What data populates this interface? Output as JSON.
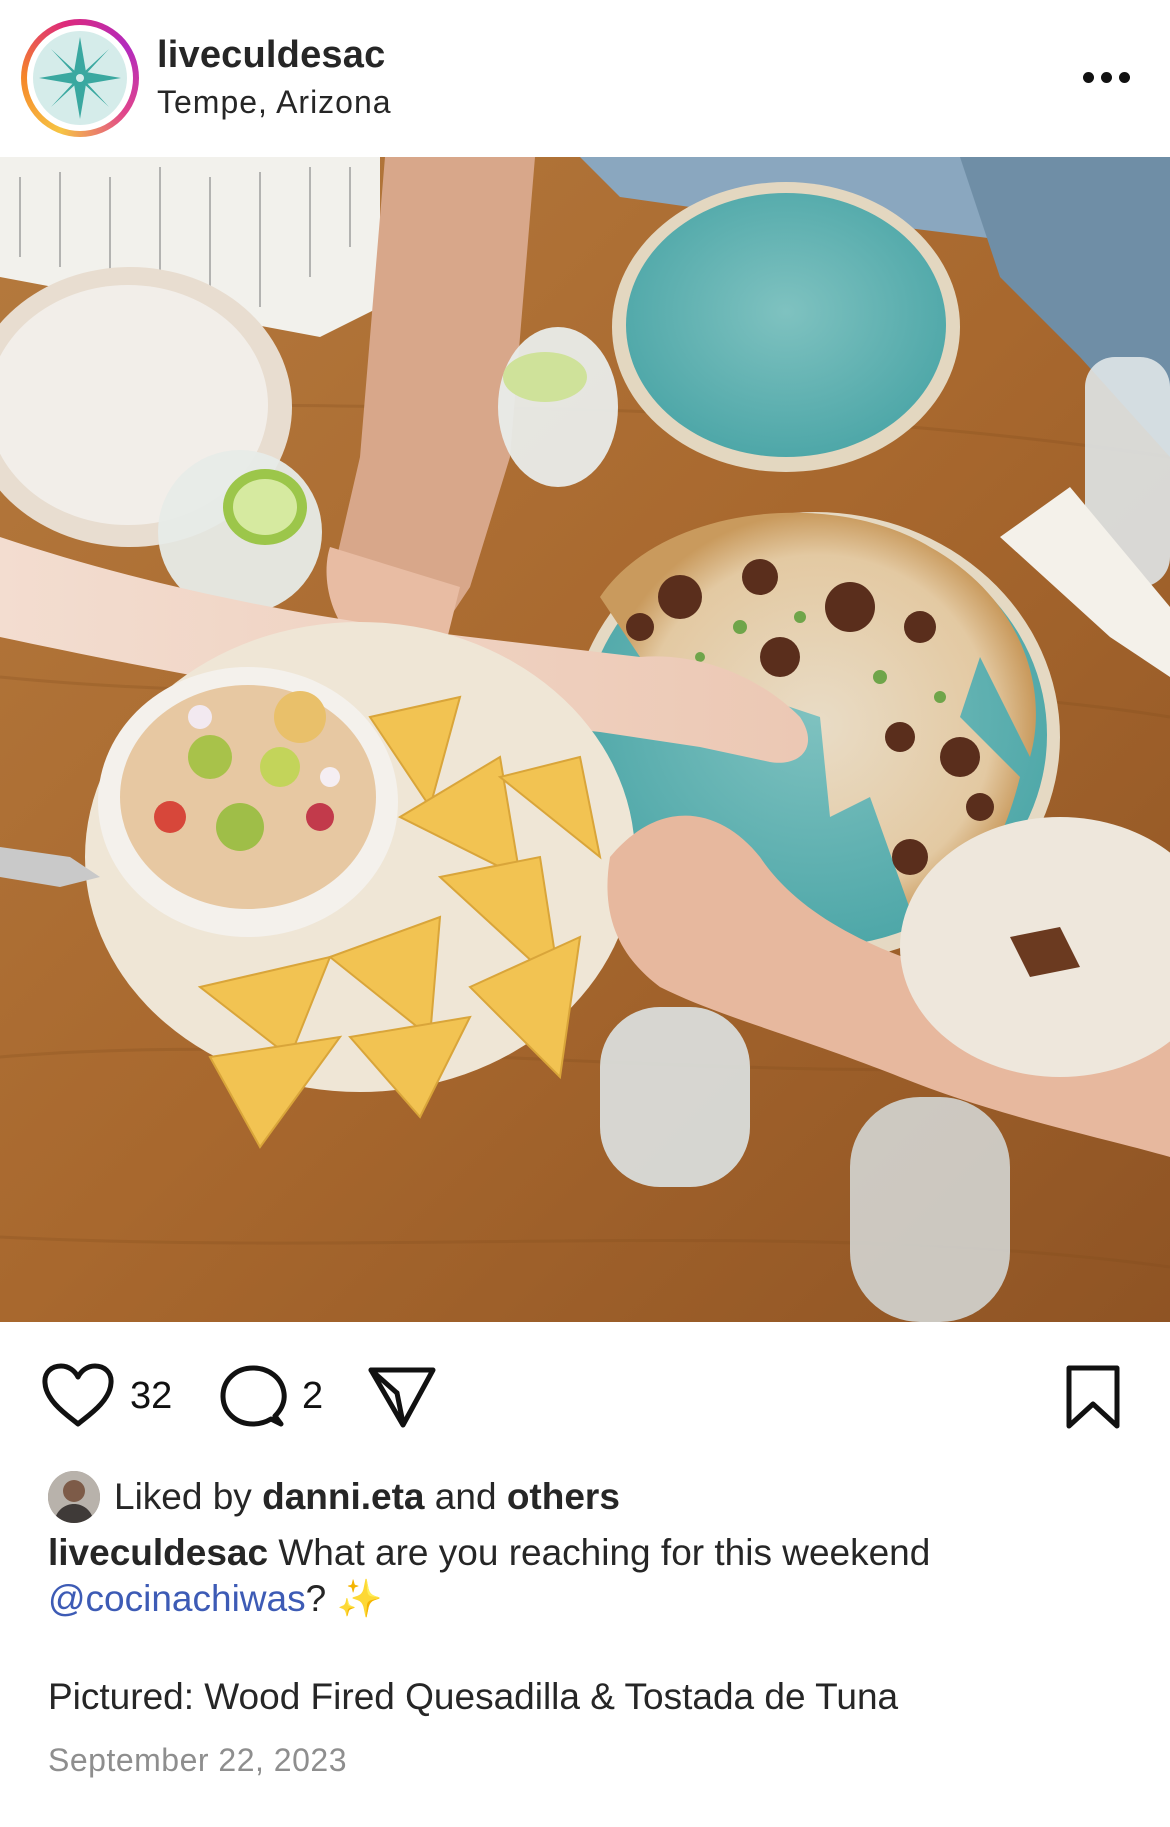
{
  "post": {
    "username": "liveculdesac",
    "location": "Tempe, Arizona",
    "avatar_icon": "compass-star-icon",
    "brand_teal": "#3aa8a0"
  },
  "actions": {
    "like_count": "32",
    "comment_count": "2"
  },
  "likes": {
    "prefix": "Liked by",
    "user": "danni.eta",
    "connector": "and",
    "others": "others"
  },
  "caption": {
    "author": "liveculdesac",
    "text": "What are you reaching for this weekend",
    "mention": "@cocinachiwas",
    "suffix": "?",
    "emoji": "✨"
  },
  "pictured": "Pictured: Wood Fired Quesadilla & Tostada de Tuna",
  "date": "September 22, 2023"
}
